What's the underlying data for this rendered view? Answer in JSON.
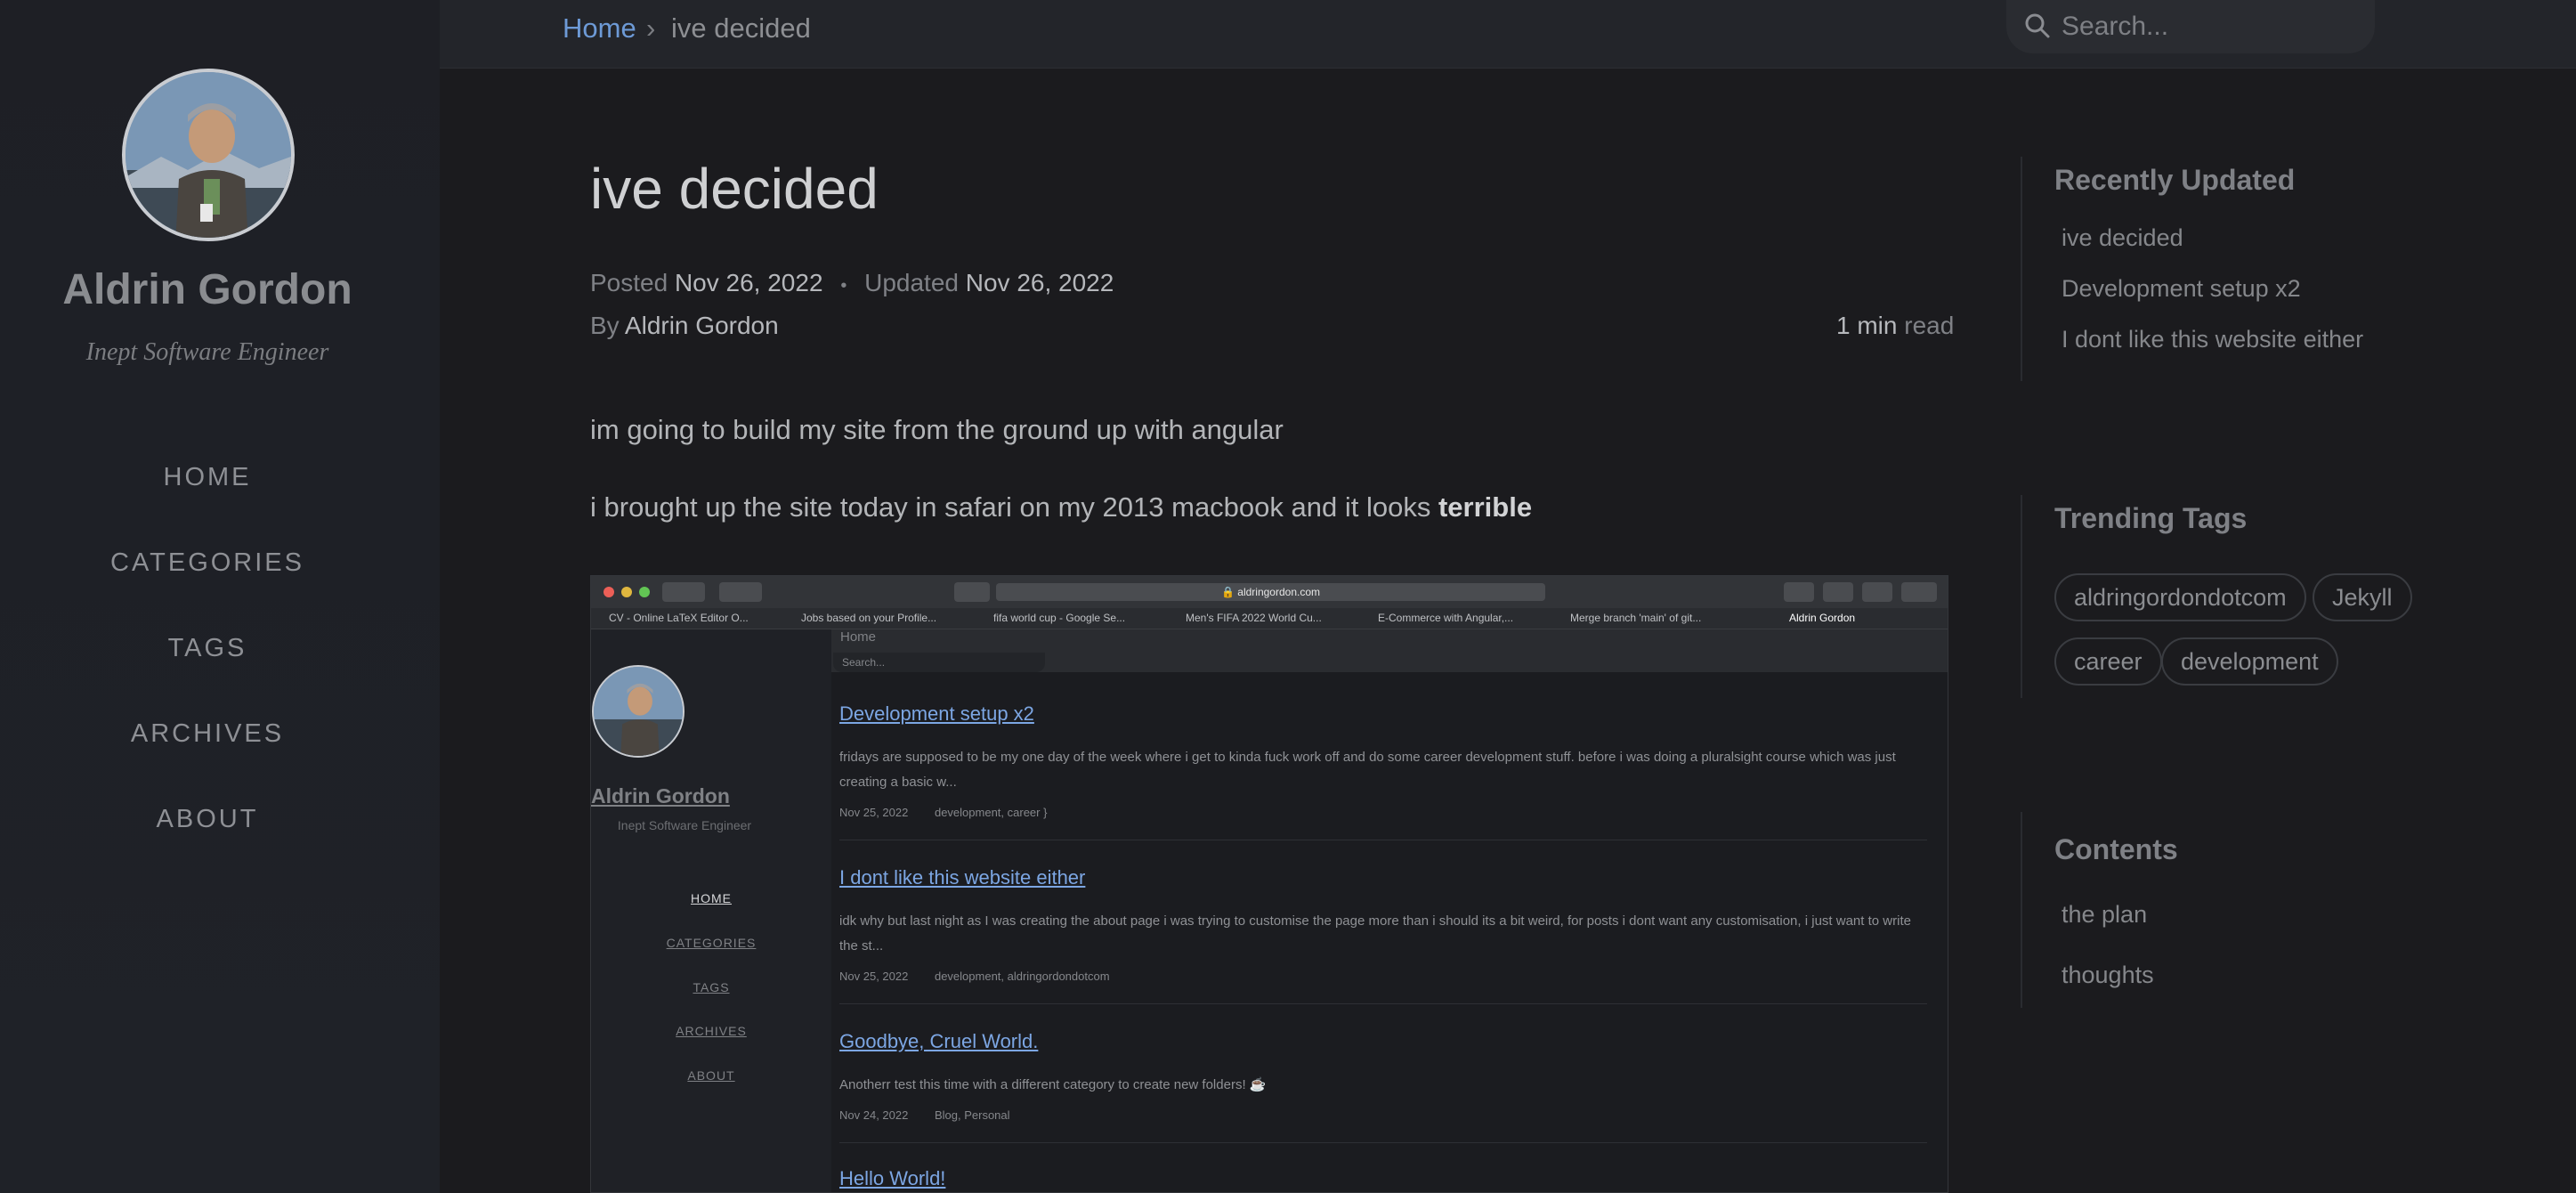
{
  "sidebar": {
    "site_title": "Aldrin Gordon",
    "site_subtitle": "Inept Software Engineer",
    "nav": [
      "HOME",
      "CATEGORIES",
      "TAGS",
      "ARCHIVES",
      "ABOUT"
    ]
  },
  "topbar": {
    "breadcrumb_home": "Home",
    "breadcrumb_separator": "›",
    "breadcrumb_current": "ive decided",
    "search_placeholder": "Search..."
  },
  "post": {
    "title": "ive decided",
    "posted_label": "Posted",
    "posted_date": "Nov 26, 2022",
    "meta_separator": "•",
    "updated_label": "Updated",
    "updated_date": "Nov 26, 2022",
    "by_label": "By",
    "author": "Aldrin Gordon",
    "read_time_value": "1 min",
    "read_time_label": "read",
    "paragraph_1": "im going to build my site from the ground up with angular",
    "paragraph_2_prefix": "i brought up the site today in safari on my 2013 macbook and it looks",
    "paragraph_2_bold": "terrible"
  },
  "screenshot": {
    "url": "🔒 aldringordon.com",
    "tabs": [
      "CV - Online LaTeX Editor O...",
      "Jobs based on your Profile...",
      "fifa world cup - Google Se...",
      "Men's FIFA 2022 World Cu...",
      "E-Commerce with Angular,...",
      "Merge branch 'main' of git...",
      "Aldrin Gordon"
    ],
    "site_title": "Aldrin Gordon",
    "site_subtitle": "Inept Software Engineer",
    "nav": [
      "HOME",
      "CATEGORIES",
      "TAGS",
      "ARCHIVES",
      "ABOUT"
    ],
    "breadcrumb": "Home",
    "search_placeholder": "Search...",
    "posts": [
      {
        "title": "Development setup x2",
        "excerpt": "fridays are supposed to be my one day of the week where i get to kinda fuck work off and do some career development stuff. before i was doing a pluralsight course which was just creating a basic w...",
        "date": "Nov 25, 2022",
        "tags": "development, career"
      },
      {
        "title": "I dont like this website either",
        "excerpt": "idk why but last night as I was creating the about page i was trying to customise the page more than i should its a bit weird, for posts i dont want any customisation, i just want to write the st...",
        "date": "Nov 25, 2022",
        "tags": "development, aldringordondotcom"
      },
      {
        "title": "Goodbye, Cruel World.",
        "excerpt": "Anotherr test this time with a different category to create new folders! ☕",
        "date": "Nov 24, 2022",
        "tags": "Blog, Personal"
      },
      {
        "title": "Hello World!",
        "excerpt": "",
        "date": "",
        "tags": ""
      }
    ]
  },
  "right": {
    "recent_title": "Recently Updated",
    "recent": [
      "ive decided",
      "Development setup x2",
      "I dont like this website either"
    ],
    "tags_title": "Trending Tags",
    "tags": [
      "aldringordondotcom",
      "Jekyll",
      "career",
      "development"
    ],
    "toc_title": "Contents",
    "toc": [
      "the plan",
      "thoughts"
    ]
  },
  "colors": {
    "background": "#1b1b1e",
    "link": "#6d9ad6",
    "sidebar": "#1e1f25"
  }
}
